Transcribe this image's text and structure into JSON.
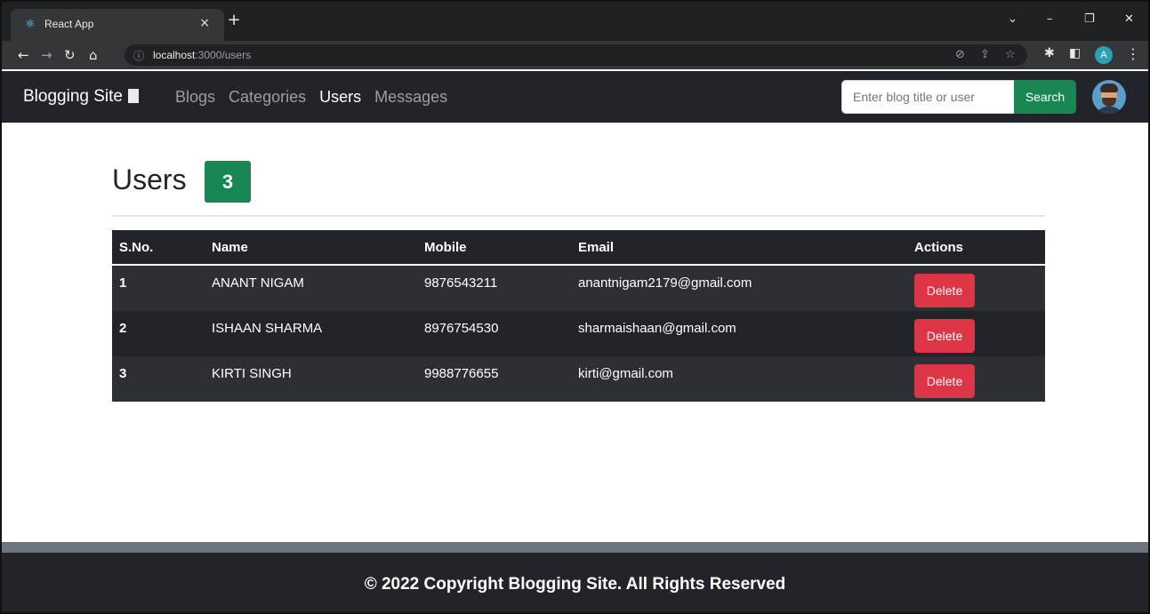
{
  "browser": {
    "tab_title": "React App",
    "tab_close": "×",
    "new_tab": "+",
    "url_host": "localhost",
    "url_path": ":3000/users",
    "profile_initial": "A"
  },
  "navbar": {
    "brand": "Blogging Site",
    "links": [
      {
        "label": "Blogs",
        "active": false
      },
      {
        "label": "Categories",
        "active": false
      },
      {
        "label": "Users",
        "active": true
      },
      {
        "label": "Messages",
        "active": false
      }
    ],
    "search_placeholder": "Enter blog title or user",
    "search_button": "Search"
  },
  "main": {
    "title": "Users",
    "count": "3",
    "table": {
      "headers": [
        "S.No.",
        "Name",
        "Mobile",
        "Email",
        "Actions"
      ],
      "rows": [
        {
          "sno": "1",
          "name": "ANANT NIGAM",
          "mobile": "9876543211",
          "email": "anantnigam2179@gmail.com",
          "action": "Delete"
        },
        {
          "sno": "2",
          "name": "ISHAAN SHARMA",
          "mobile": "8976754530",
          "email": "sharmaishaan@gmail.com",
          "action": "Delete"
        },
        {
          "sno": "3",
          "name": "KIRTI SINGH",
          "mobile": "9988776655",
          "email": "kirti@gmail.com",
          "action": "Delete"
        }
      ]
    }
  },
  "footer": {
    "text": "© 2022 Copyright Blogging Site. All Rights Reserved"
  },
  "colors": {
    "navbar_bg": "#212529",
    "success": "#198754",
    "danger": "#dc3545"
  },
  "icons": {
    "favicon": "react-icon",
    "brand": "book-icon",
    "info": "info-icon"
  }
}
